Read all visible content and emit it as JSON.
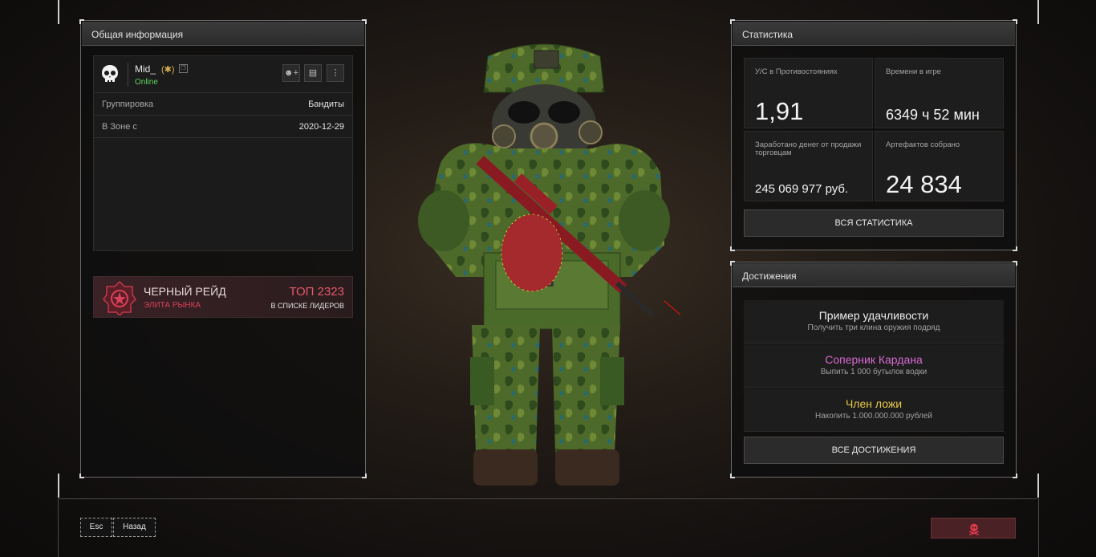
{
  "general": {
    "title": "Общая информация",
    "player": {
      "name": "Mid_",
      "status": "Online"
    },
    "rows": [
      {
        "key": "Группировка",
        "value": "Бандиты"
      },
      {
        "key": "В Зоне с",
        "value": "2020-12-29"
      }
    ],
    "raid": {
      "title": "ЧЕРНЫЙ РЕЙД",
      "subtitle": "ЭЛИТА РЫНКА",
      "rank": "ТОП 2323",
      "rank_caption": "В СПИСКЕ ЛИДЕРОВ"
    }
  },
  "stats": {
    "title": "Статистика",
    "cells": [
      {
        "label": "У/С в Противостояниях",
        "value": "1,91"
      },
      {
        "label": "Времени в игре",
        "value": "6349 ч 52 мин"
      },
      {
        "label": "Заработано денег от продажи торговцам",
        "value": "245 069 977 руб."
      },
      {
        "label": "Артефактов собрано",
        "value": "24 834"
      }
    ],
    "button": "ВСЯ СТАТИСТИКА"
  },
  "achievements": {
    "title": "Достижения",
    "items": [
      {
        "title": "Пример удачливости",
        "desc": "Получить три клина оружия подряд",
        "color": "#ececec"
      },
      {
        "title": "Соперник Кардана",
        "desc": "Выпить 1 000 бутылок водки",
        "color": "#d76ad0"
      },
      {
        "title": "Член ложи",
        "desc": "Накопить 1.000.000.000 рублей",
        "color": "#e8c84a"
      }
    ],
    "button": "ВСЕ ДОСТИЖЕНИЯ"
  },
  "footer": {
    "esc_key": "Esc",
    "back_label": "Назад"
  },
  "icons": [
    "skull-icon",
    "add-friend-icon",
    "message-icon",
    "more-icon",
    "copy-icon",
    "clan-badge-icon",
    "raid-emblem-icon",
    "pirate-skull-icon"
  ]
}
